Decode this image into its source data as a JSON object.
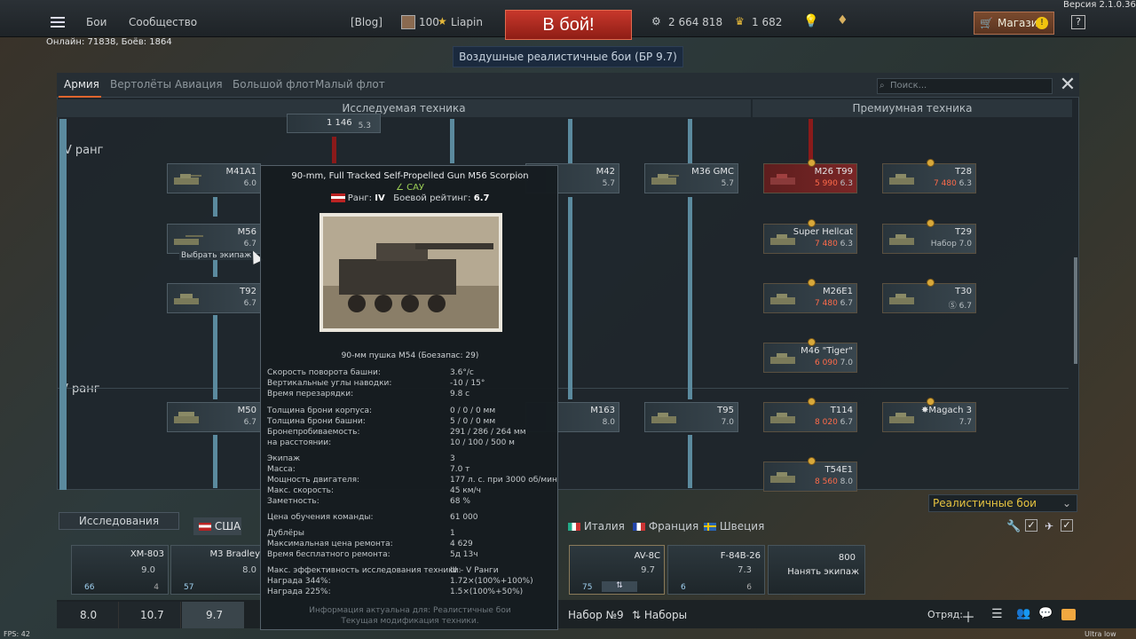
{
  "version": "Версия 2.1.0.36",
  "topbar": {
    "battles": "Бои",
    "community": "Сообщество",
    "blog": "[Blog]",
    "level": "100",
    "username": "Liapin",
    "battle_button": "В бой!",
    "silver_lions": "2 664 818",
    "golden_eagles": "1 682",
    "shop": "Магазин",
    "help": "?"
  },
  "online": "Онлайн: 71838, Боёв: 1864",
  "game_mode": "Воздушные реалистичные бои (БР 9.7)",
  "tabs": [
    "Армия",
    "Вертолёты",
    "Авиация",
    "Большой флот",
    "Малый флот"
  ],
  "search_placeholder": "Поиск...",
  "research_header": "Исследуемая техника",
  "premium_header": "Премиумная техника",
  "ranks": {
    "iv": "IV ранг",
    "v": "V ранг"
  },
  "top_partial": {
    "cost": "1 146",
    "br": "5.3"
  },
  "research_vehicles": [
    {
      "name": "M41A1",
      "br": "6.0"
    },
    {
      "name": "M56",
      "br": "6.7",
      "hint": "Выбрать экипаж"
    },
    {
      "name": "T92",
      "br": "6.7"
    },
    {
      "name": "M50",
      "br": "6.7"
    },
    {
      "name": "M42",
      "br": "5.7"
    },
    {
      "name": "M36 GMC",
      "br": "5.7"
    },
    {
      "name": "M163",
      "br": "8.0"
    },
    {
      "name": "T95",
      "br": "7.0"
    }
  ],
  "premium_vehicles": [
    {
      "name": "M26 T99",
      "price": "5 990",
      "br": "6.3"
    },
    {
      "name": "T28",
      "price": "7 480",
      "br": "6.3"
    },
    {
      "name": "Super Hellcat",
      "price": "7 480",
      "br": "6.3"
    },
    {
      "name": "T29",
      "price": "Набор",
      "br": "7.0"
    },
    {
      "name": "M26E1",
      "price": "7 480",
      "br": "6.7"
    },
    {
      "name": "T30",
      "price": "",
      "br": "6.7"
    },
    {
      "name": "M46 \"Tiger\"",
      "price": "6 090",
      "br": "7.0"
    },
    {
      "name": "T114",
      "price": "8 020",
      "br": "6.7"
    },
    {
      "name": "✸Magach 3",
      "price": "",
      "br": "7.7"
    },
    {
      "name": "T54E1",
      "price": "8 560",
      "br": "8.0"
    }
  ],
  "tooltip": {
    "title": "90-mm, Full Tracked Self-Propelled Gun M56 Scorpion",
    "type": "САУ",
    "rank_label": "Ранг:",
    "rank": "IV",
    "br_label": "Боевой рейтинг:",
    "br": "6.7",
    "weapon": "90-мм пушка M54 (Боезапас: 29)",
    "rows": [
      [
        "Скорость поворота башни:",
        "3.6°/с"
      ],
      [
        "Вертикальные углы наводки:",
        "-10 / 15°"
      ],
      [
        "Время перезарядки:",
        "9.8 с"
      ],
      [
        "Толщина брони корпуса:",
        "0 / 0 / 0 мм"
      ],
      [
        "Толщина брони башни:",
        "5 / 0 / 0 мм"
      ],
      [
        "Бронепробиваемость:",
        "291 / 286 / 264 мм"
      ],
      [
        "на расстоянии:",
        "10 / 100 / 500 м"
      ],
      [
        "Экипаж",
        "3"
      ],
      [
        "Масса:",
        "7.0 т"
      ],
      [
        "Мощность двигателя:",
        "177 л. с. при 3000 об/мин"
      ],
      [
        "Макс. скорость:",
        "45 км/ч"
      ],
      [
        "Заметность:",
        "68 %"
      ],
      [
        "Цена обучения команды:",
        "61 000"
      ],
      [
        "Дублёры",
        "1"
      ],
      [
        "Максимальная цена ремонта:",
        "4 629"
      ],
      [
        "Время бесплатного ремонта:",
        "5д 13ч"
      ],
      [
        "Макс. эффективность исследования техники:",
        "III – V Ранги"
      ],
      [
        "Награда 344%:",
        "1.72×(100%+100%)"
      ],
      [
        "Награда 225%:",
        "1.5×(100%+50%)"
      ]
    ],
    "footer1": "Информация актуальна для: Реалистичные бои",
    "footer2": "Текущая модификация техники."
  },
  "research_dropdown": "Исследования",
  "nations": [
    "США",
    "Италия",
    "Франция",
    "Швеция"
  ],
  "battle_mode_select": "Реалистичные бои",
  "crew_cards": [
    {
      "name": "XM-803",
      "br": "9.0",
      "a": "66",
      "b": "4"
    },
    {
      "name": "M3 Bradley",
      "br": "8.0",
      "a": "57",
      "b": ""
    },
    {
      "name": "AV-8C",
      "br": "9.7",
      "a": "75",
      "b": ""
    },
    {
      "name": "F-84B-26",
      "br": "7.3",
      "a": "6",
      "b": "6"
    }
  ],
  "hire_crew": {
    "cost": "800",
    "label": "Нанять экипаж"
  },
  "presets": [
    "8.0",
    "10.7",
    "9.7",
    "Набор №9",
    "Наборы"
  ],
  "squad": "Отряд:",
  "fps": "FPS: 42",
  "quality": "Ultra low quality"
}
